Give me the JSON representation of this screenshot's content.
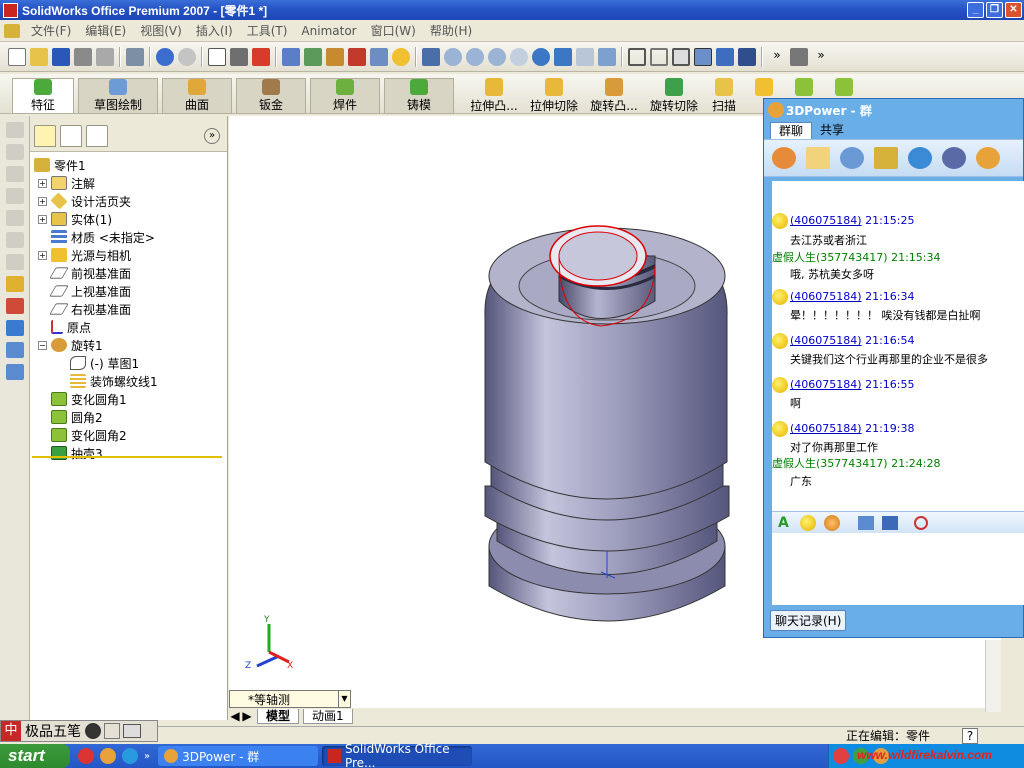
{
  "window": {
    "title": "SolidWorks Office Premium 2007 - [零件1 *]"
  },
  "menu": [
    "文件(F)",
    "编辑(E)",
    "视图(V)",
    "插入(I)",
    "工具(T)",
    "Animator",
    "窗口(W)",
    "帮助(H)"
  ],
  "command_manager": {
    "tabs": [
      "特征",
      "草图绘制",
      "曲面",
      "钣金",
      "焊件",
      "铸模"
    ],
    "commands": [
      "拉伸凸...",
      "拉伸切除",
      "旋转凸...",
      "旋转切除",
      "扫描"
    ]
  },
  "feature_tree": {
    "root": "零件1",
    "items": [
      "注解",
      "设计活页夹",
      "实体(1)",
      "材质 <未指定>",
      "光源与相机",
      "前视基准面",
      "上视基准面",
      "右视基准面",
      "原点",
      "旋转1",
      "(-) 草图1",
      "装饰螺纹线1",
      "变化圆角1",
      "圆角2",
      "变化圆角2",
      "抽壳3"
    ]
  },
  "viewport": {
    "view_name": "*等轴测",
    "tabs": [
      "模型",
      "动画1"
    ],
    "triad": {
      "x": "X",
      "y": "Y",
      "z": "Z"
    }
  },
  "status": {
    "editing": "正在编辑：零件",
    "help": "?"
  },
  "ime": {
    "label": "极品五笔"
  },
  "taskbar": {
    "start": "start",
    "tasks": [
      "3DPower - 群",
      "SolidWorks Office Pre..."
    ],
    "watermark": "www.wildfirekalvin.com"
  },
  "qq": {
    "title": "3DPower - 群",
    "tabs": [
      "群聊",
      "共享"
    ],
    "messages": [
      {
        "sender": "(406075184)",
        "time": "21:15:25",
        "text": "去江苏或者浙江",
        "emote": true,
        "color": "blue"
      },
      {
        "sender": "虚假人生(357743417)",
        "time": "21:15:34",
        "text": "哦, 苏杭美女多呀",
        "emote": false,
        "color": "green"
      },
      {
        "sender": "(406075184)",
        "time": "21:16:34",
        "text": "晕！！！！！！！ 唉没有钱都是白扯啊",
        "emote": true,
        "color": "blue"
      },
      {
        "sender": "(406075184)",
        "time": "21:16:54",
        "text": "关键我们这个行业再那里的企业不是很多",
        "emote": true,
        "color": "blue"
      },
      {
        "sender": "(406075184)",
        "time": "21:16:55",
        "text": "啊",
        "emote": true,
        "color": "blue"
      },
      {
        "sender": "(406075184)",
        "time": "21:19:38",
        "text": "对了你再那里工作",
        "emote": true,
        "color": "blue"
      },
      {
        "sender": "虚假人生(357743417)",
        "time": "21:24:28",
        "text": "广东",
        "emote": false,
        "color": "green"
      }
    ],
    "history_button": "聊天记录(H)"
  }
}
